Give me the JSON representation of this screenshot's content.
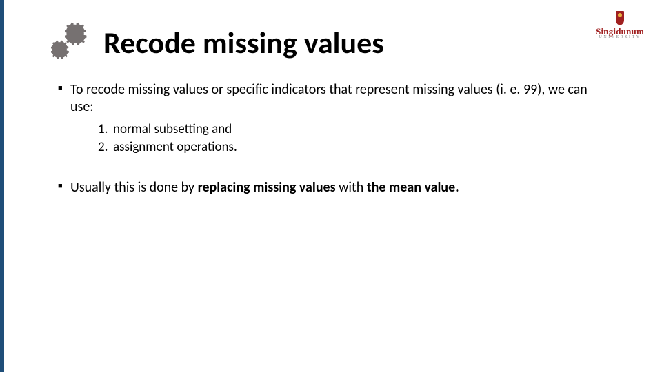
{
  "title": "Recode missing values",
  "logo": {
    "name": "Singidunum",
    "sub": "UNIVERSITY"
  },
  "body": {
    "p1": "To recode missing values or specific indicators that represent missing values (i. e. 99), we can use:",
    "list": {
      "n1": "1.",
      "i1": "normal subsetting and",
      "n2": "2.",
      "i2": "assignment operations."
    },
    "p2_a": "Usually this is done by ",
    "p2_b": "replacing missing values",
    "p2_c": " with ",
    "p2_d": "the mean value.",
    "p2_e": ""
  }
}
